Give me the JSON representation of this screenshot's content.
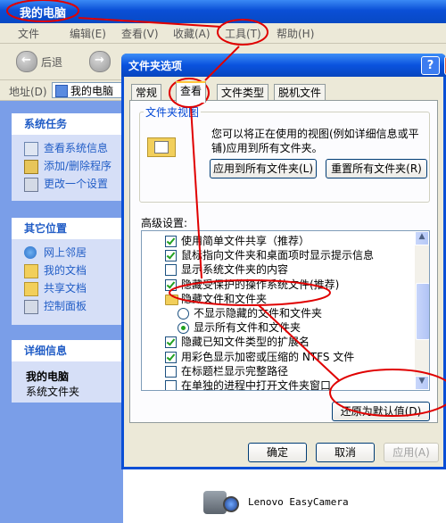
{
  "explorer": {
    "title": "我的电脑",
    "menu": [
      "文件",
      "编辑(E)",
      "查看(V)",
      "收藏(A)",
      "工具(T)",
      "帮助(H)"
    ],
    "toolbar": {
      "back_label": "后退"
    },
    "address": {
      "label": "地址(D)",
      "value": "我的电脑"
    },
    "panels": {
      "tasks": {
        "title": "系统任务",
        "items": [
          "查看系统信息",
          "添加/删除程序",
          "更改一个设置"
        ]
      },
      "places": {
        "title": "其它位置",
        "items": [
          "网上邻居",
          "我的文档",
          "共享文档",
          "控制面板"
        ]
      },
      "details": {
        "title": "详细信息",
        "name": "我的电脑",
        "desc": "系统文件夹"
      }
    }
  },
  "dialog": {
    "title": "文件夹选项",
    "help_btn": "?",
    "close_btn": "✕",
    "tabs": [
      "常规",
      "查看",
      "文件类型",
      "脱机文件"
    ],
    "active_tab": "查看",
    "folder_views": {
      "legend": "文件夹视图",
      "desc": "您可以将正在使用的视图(例如详细信息或平铺)应用到所有文件夹。",
      "apply_all": "应用到所有文件夹(L)",
      "reset_all": "重置所有文件夹(R)"
    },
    "advanced_label": "高级设置:",
    "advanced_items": [
      {
        "kind": "checkbox",
        "checked": true,
        "indent": 0,
        "label": "使用简单文件共享（推荐）"
      },
      {
        "kind": "checkbox",
        "checked": true,
        "indent": 0,
        "label": "鼠标指向文件夹和桌面项时显示提示信息"
      },
      {
        "kind": "checkbox",
        "checked": false,
        "indent": 0,
        "label": "显示系统文件夹的内容"
      },
      {
        "kind": "checkbox",
        "checked": true,
        "indent": 0,
        "label": "隐藏受保护的操作系统文件(推荐)"
      },
      {
        "kind": "folder",
        "indent": 0,
        "label": "隐藏文件和文件夹"
      },
      {
        "kind": "radio",
        "checked": false,
        "indent": 1,
        "label": "不显示隐藏的文件和文件夹"
      },
      {
        "kind": "radio",
        "checked": true,
        "indent": 1,
        "label": "显示所有文件和文件夹"
      },
      {
        "kind": "checkbox",
        "checked": true,
        "indent": 0,
        "label": "隐藏已知文件类型的扩展名"
      },
      {
        "kind": "checkbox",
        "checked": true,
        "indent": 0,
        "label": "用彩色显示加密或压缩的 NTFS 文件"
      },
      {
        "kind": "checkbox",
        "checked": false,
        "indent": 0,
        "label": "在标题栏显示完整路径"
      },
      {
        "kind": "checkbox",
        "checked": false,
        "indent": 0,
        "label": "在单独的进程中打开文件夹窗口"
      }
    ],
    "restore_defaults": "还原为默认值(D)",
    "ok": "确定",
    "cancel": "取消",
    "apply": "应用(A)"
  },
  "camera": {
    "label": "Lenovo EasyCamera"
  },
  "colors": {
    "annotation": "#e00000",
    "xp_blue": "#0a4fd6",
    "link": "#215dc6"
  }
}
